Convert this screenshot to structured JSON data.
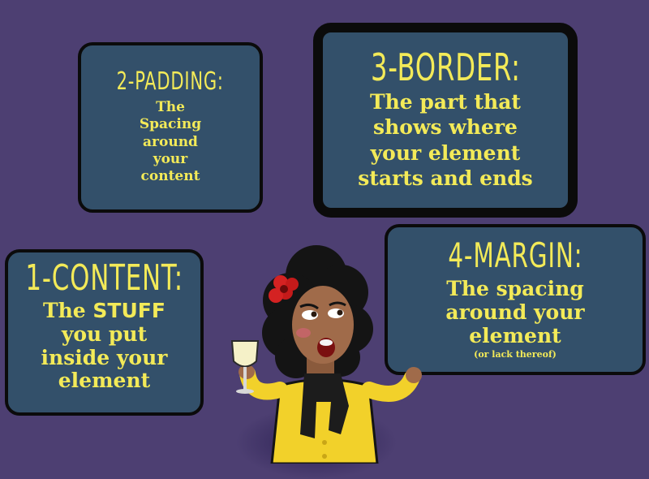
{
  "cards": {
    "content": {
      "title": "1-CONTENT:",
      "line1_pre": "The ",
      "line1_strong": "STUFF",
      "line2": "you put",
      "line3": "inside your",
      "line4": "element"
    },
    "padding": {
      "title": "2-PADDING:",
      "lines": [
        "The",
        "Spacing",
        "around",
        "your",
        "content"
      ]
    },
    "border": {
      "title": "3-BORDER:",
      "lines": [
        "The part that",
        "shows where",
        "your element",
        "starts and ends"
      ]
    },
    "margin": {
      "title": "4-MARGIN:",
      "lines": [
        "The spacing",
        "around your",
        "element"
      ],
      "note": "(or lack thereof)"
    }
  },
  "colors": {
    "background": "#4d3f72",
    "card": "#33506a",
    "text": "#f3ea58",
    "border": "#0b0b0b",
    "jacket": "#f2d12a"
  }
}
